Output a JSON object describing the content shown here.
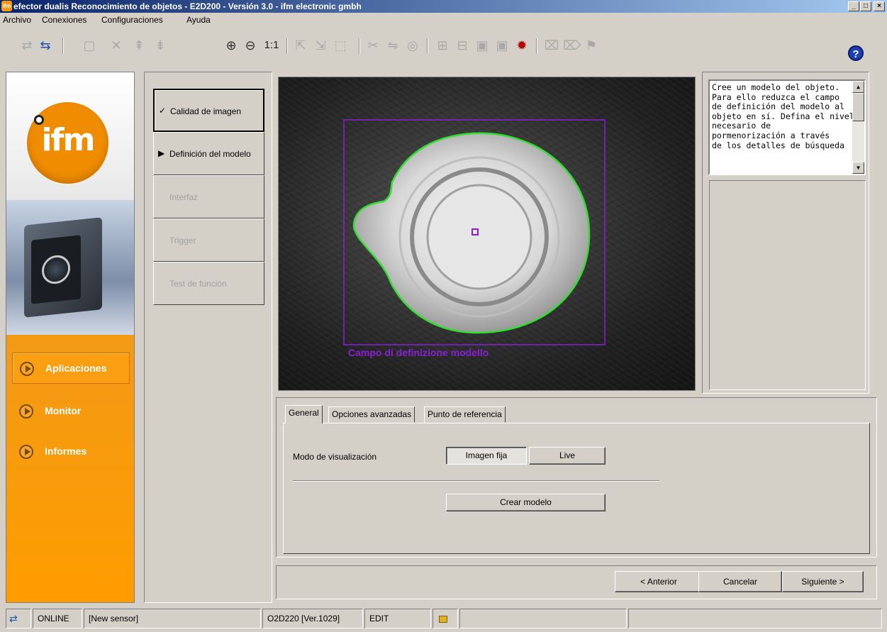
{
  "window": {
    "title": "efector dualis Reconocimiento de objetos - E2D200 - Versión 3.0 - ifm electronic gmbh",
    "app_icon": "ifm"
  },
  "menu": [
    "Archivo",
    "Conexiones",
    "Configuraciones",
    "Ayuda"
  ],
  "toolbar": {
    "zoom_reset_label": "1:1",
    "help_icon": "?"
  },
  "sidebar": {
    "logo_text": "ifm",
    "nav": [
      {
        "label": "Aplicaciones",
        "active": true
      },
      {
        "label": "Monitor",
        "active": false
      },
      {
        "label": "Informes",
        "active": false
      }
    ]
  },
  "steps": [
    {
      "label": "Calidad de imagen",
      "mark": "✓",
      "state": "active"
    },
    {
      "label": "Definición del modelo",
      "mark": "▶",
      "state": "current"
    },
    {
      "label": "Interfaz",
      "mark": "",
      "state": "disabled"
    },
    {
      "label": "Trigger",
      "mark": "",
      "state": "disabled"
    },
    {
      "label": "Test de función",
      "mark": "",
      "state": "disabled"
    }
  ],
  "image": {
    "roi_label": "Campo di definizione modello",
    "roi_color": "#8a1fd6",
    "contour_color": "#30e030"
  },
  "help": {
    "lines": [
      "Cree un modelo del objeto.",
      "Para ello reduzca el campo",
      "de definición del modelo al",
      "objeto en sí. Defina el nivel",
      "necesario de",
      "pormenorización a través",
      "de los detalles de búsqueda"
    ]
  },
  "tabs": [
    "General",
    "Opciones avanzadas",
    "Punto de referencia"
  ],
  "general": {
    "display_mode_label": "Modo de visualización",
    "still_label": "Imagen fija",
    "live_label": "Live",
    "create_model_label": "Crear modelo"
  },
  "nav_buttons": {
    "prev": "< Anterior",
    "cancel": "Cancelar",
    "next": "Siguiente >"
  },
  "status": {
    "connection": "ONLINE",
    "sensor_name": "[New sensor]",
    "device": "O2D220  [Ver.1029]",
    "mode": "EDIT"
  }
}
